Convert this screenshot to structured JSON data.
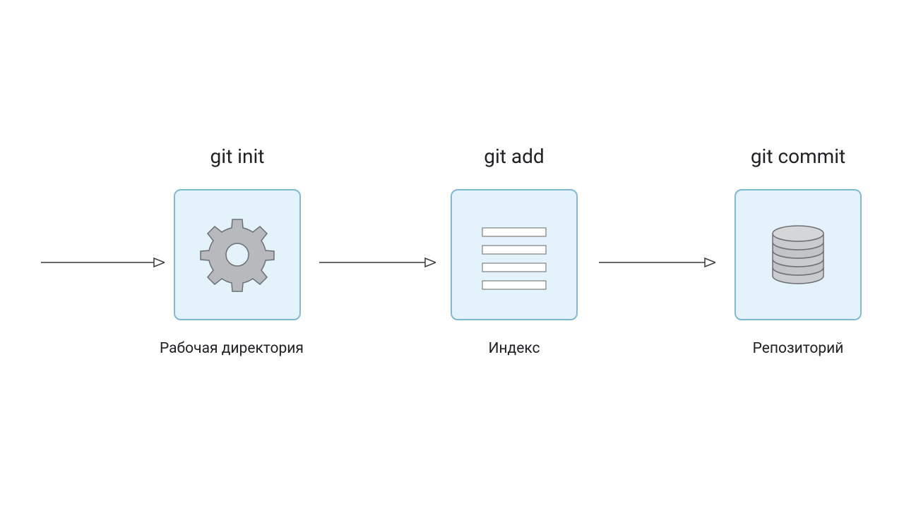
{
  "stages": [
    {
      "command": "git init",
      "label": "Рабочая директория"
    },
    {
      "command": "git add",
      "label": "Индекс"
    },
    {
      "command": "git commit",
      "label": "Репозиторий"
    }
  ],
  "colors": {
    "cardFill": "#e3f2fb",
    "cardBorder": "#7eb9d6",
    "iconGrey": "#b7b9bc",
    "iconGreyDark": "#8c8f93",
    "arrow": "#3a3a3a",
    "text": "#202124"
  }
}
